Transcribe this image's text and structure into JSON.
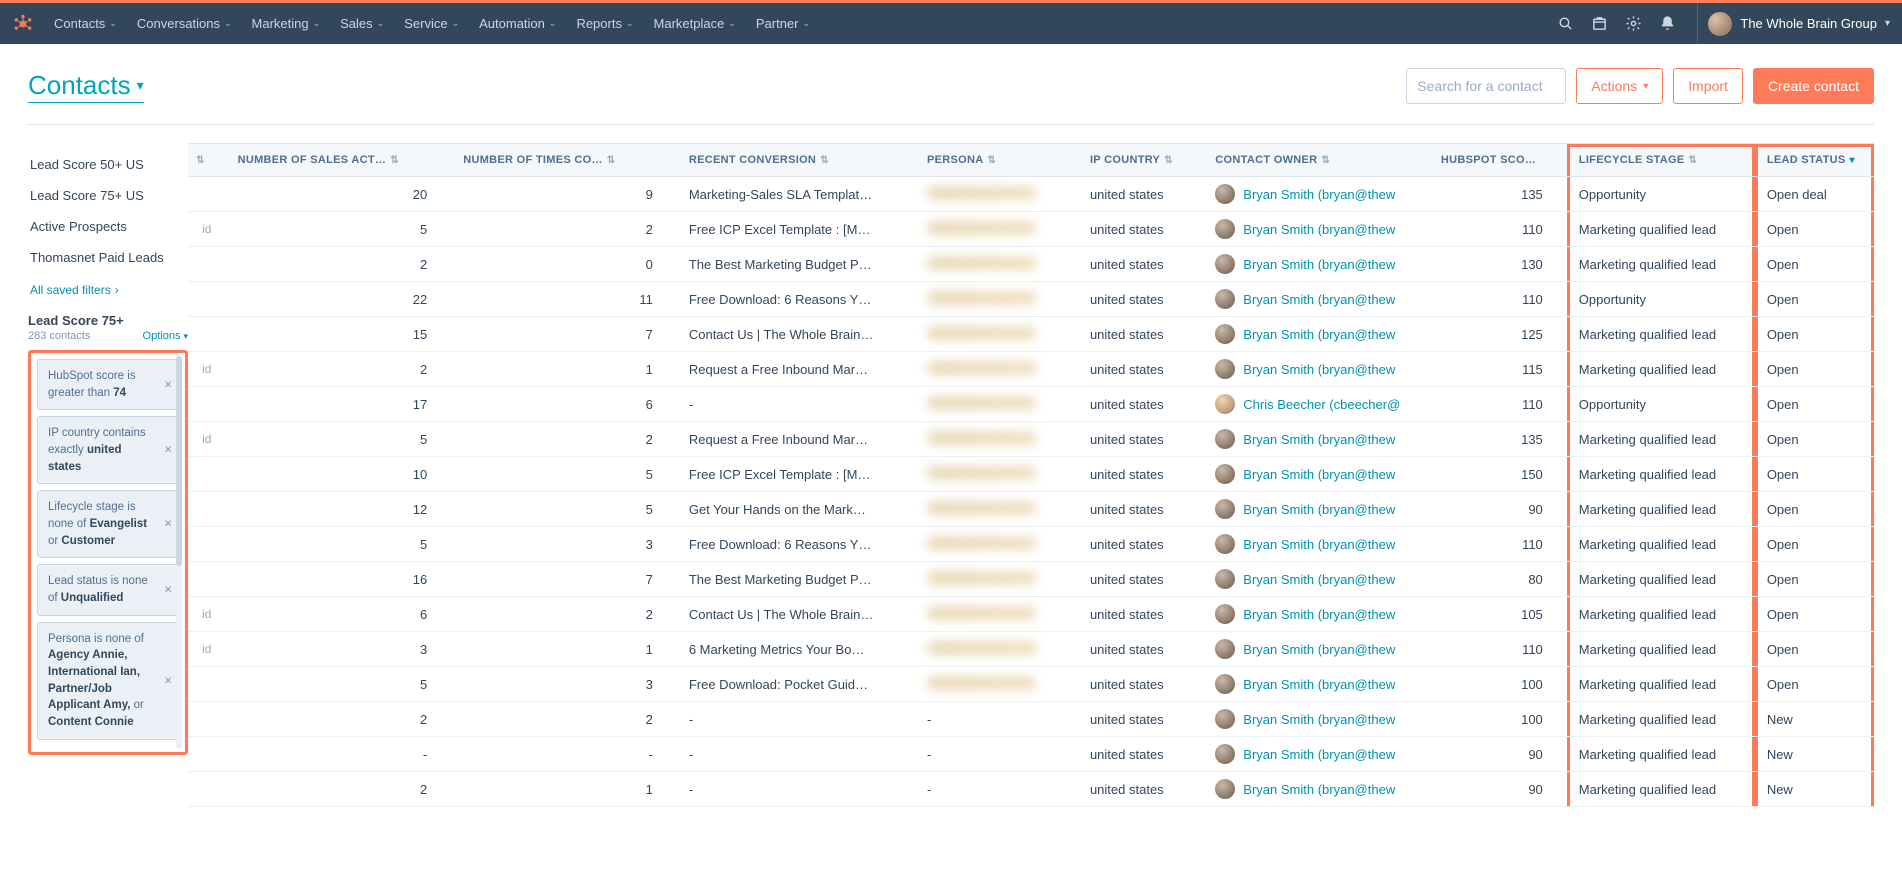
{
  "nav": {
    "items": [
      "Contacts",
      "Conversations",
      "Marketing",
      "Sales",
      "Service",
      "Automation",
      "Reports",
      "Marketplace",
      "Partner"
    ],
    "account": "The Whole Brain Group"
  },
  "page": {
    "title": "Contacts",
    "search_placeholder": "Search for a contact",
    "actions_label": "Actions",
    "import_label": "Import",
    "create_label": "Create contact"
  },
  "sidebar": {
    "saved": [
      "Lead Score 50+ US",
      "Lead Score 75+ US",
      "Active Prospects",
      "Thomasnet Paid Leads"
    ],
    "all_saved_label": "All saved filters",
    "current_filter": "Lead Score 75+",
    "count_label": "283 contacts",
    "options_label": "Options",
    "chips": [
      {
        "pre": "HubSpot score is greater than ",
        "bold": "74",
        "post": ""
      },
      {
        "pre": "IP country contains exactly ",
        "bold": "united states",
        "post": ""
      },
      {
        "pre": "Lifecycle stage is none of ",
        "bold": "Evangelist",
        "post": " or ",
        "bold2": "Customer"
      },
      {
        "pre": "Lead status is none of ",
        "bold": "Unqualified",
        "post": ""
      },
      {
        "pre": "Persona is none of ",
        "bold": "Agency Annie, International Ian, Partner/Job Applicant Amy,",
        "post": " or ",
        "bold2": "Content Connie"
      }
    ]
  },
  "table": {
    "headers": {
      "stub": "",
      "sales_act": "NUMBER OF SALES ACT…",
      "times_co": "NUMBER OF TIMES CO…",
      "recent_conv": "RECENT CONVERSION",
      "persona": "PERSONA",
      "ip_country": "IP COUNTRY",
      "owner": "CONTACT OWNER",
      "hs_score": "HUBSPOT SCORE",
      "lifecycle": "LIFECYCLE STAGE",
      "lead_status": "LEAD STATUS"
    },
    "rows": [
      {
        "stub": "",
        "sa": "20",
        "tc": "9",
        "rc": "Marketing-Sales SLA Templat…",
        "persona": true,
        "ip": "united states",
        "owner": "Bryan Smith (bryan@thew",
        "hs": "135",
        "ls": "Opportunity",
        "st": "Open deal"
      },
      {
        "stub": "id",
        "sa": "5",
        "tc": "2",
        "rc": "Free ICP Excel Template : [M…",
        "persona": true,
        "ip": "united states",
        "owner": "Bryan Smith (bryan@thew",
        "hs": "110",
        "ls": "Marketing qualified lead",
        "st": "Open"
      },
      {
        "stub": "",
        "sa": "2",
        "tc": "0",
        "rc": "The Best Marketing Budget P…",
        "persona": true,
        "ip": "united states",
        "owner": "Bryan Smith (bryan@thew",
        "hs": "130",
        "ls": "Marketing qualified lead",
        "st": "Open"
      },
      {
        "stub": "",
        "sa": "22",
        "tc": "11",
        "rc": "Free Download: 6 Reasons Y…",
        "persona": true,
        "ip": "united states",
        "owner": "Bryan Smith (bryan@thew",
        "hs": "110",
        "ls": "Opportunity",
        "st": "Open"
      },
      {
        "stub": "",
        "sa": "15",
        "tc": "7",
        "rc": "Contact Us | The Whole Brain…",
        "persona": true,
        "ip": "united states",
        "owner": "Bryan Smith (bryan@thew",
        "hs": "125",
        "ls": "Marketing qualified lead",
        "st": "Open"
      },
      {
        "stub": "id",
        "sa": "2",
        "tc": "1",
        "rc": "Request a Free Inbound Mar…",
        "persona": true,
        "ip": "united states",
        "owner": "Bryan Smith (bryan@thew",
        "hs": "115",
        "ls": "Marketing qualified lead",
        "st": "Open"
      },
      {
        "stub": "",
        "sa": "17",
        "tc": "6",
        "rc": "-",
        "persona": true,
        "ip": "united states",
        "owner": "Chris Beecher (cbeecher@",
        "owner_alt": true,
        "hs": "110",
        "ls": "Opportunity",
        "st": "Open"
      },
      {
        "stub": "id",
        "sa": "5",
        "tc": "2",
        "rc": "Request a Free Inbound Mar…",
        "persona": true,
        "ip": "united states",
        "owner": "Bryan Smith (bryan@thew",
        "hs": "135",
        "ls": "Marketing qualified lead",
        "st": "Open"
      },
      {
        "stub": "",
        "sa": "10",
        "tc": "5",
        "rc": "Free ICP Excel Template : [M…",
        "persona": true,
        "ip": "united states",
        "owner": "Bryan Smith (bryan@thew",
        "hs": "150",
        "ls": "Marketing qualified lead",
        "st": "Open"
      },
      {
        "stub": "",
        "sa": "12",
        "tc": "5",
        "rc": "Get Your Hands on the Mark…",
        "persona": true,
        "ip": "united states",
        "owner": "Bryan Smith (bryan@thew",
        "hs": "90",
        "ls": "Marketing qualified lead",
        "st": "Open"
      },
      {
        "stub": "",
        "sa": "5",
        "tc": "3",
        "rc": "Free Download: 6 Reasons Y…",
        "persona": true,
        "ip": "united states",
        "owner": "Bryan Smith (bryan@thew",
        "hs": "110",
        "ls": "Marketing qualified lead",
        "st": "Open"
      },
      {
        "stub": "",
        "sa": "16",
        "tc": "7",
        "rc": "The Best Marketing Budget P…",
        "persona": true,
        "ip": "united states",
        "owner": "Bryan Smith (bryan@thew",
        "hs": "80",
        "ls": "Marketing qualified lead",
        "st": "Open"
      },
      {
        "stub": "id",
        "sa": "6",
        "tc": "2",
        "rc": "Contact Us | The Whole Brain…",
        "persona": true,
        "ip": "united states",
        "owner": "Bryan Smith (bryan@thew",
        "hs": "105",
        "ls": "Marketing qualified lead",
        "st": "Open"
      },
      {
        "stub": "id",
        "sa": "3",
        "tc": "1",
        "rc": "6 Marketing Metrics Your Bo…",
        "persona": true,
        "ip": "united states",
        "owner": "Bryan Smith (bryan@thew",
        "hs": "110",
        "ls": "Marketing qualified lead",
        "st": "Open"
      },
      {
        "stub": "",
        "sa": "5",
        "tc": "3",
        "rc": "Free Download: Pocket Guid…",
        "persona": true,
        "ip": "united states",
        "owner": "Bryan Smith (bryan@thew",
        "hs": "100",
        "ls": "Marketing qualified lead",
        "st": "Open"
      },
      {
        "stub": "",
        "sa": "2",
        "tc": "2",
        "rc": "-",
        "persona": false,
        "ip": "united states",
        "owner": "Bryan Smith (bryan@thew",
        "hs": "100",
        "ls": "Marketing qualified lead",
        "st": "New"
      },
      {
        "stub": "",
        "sa": "-",
        "tc": "-",
        "rc": "-",
        "persona": false,
        "ip": "united states",
        "owner": "Bryan Smith (bryan@thew",
        "hs": "90",
        "ls": "Marketing qualified lead",
        "st": "New"
      },
      {
        "stub": "",
        "sa": "2",
        "tc": "1",
        "rc": "-",
        "persona": false,
        "ip": "united states",
        "owner": "Bryan Smith (bryan@thew",
        "hs": "90",
        "ls": "Marketing qualified lead",
        "st": "New"
      }
    ]
  }
}
